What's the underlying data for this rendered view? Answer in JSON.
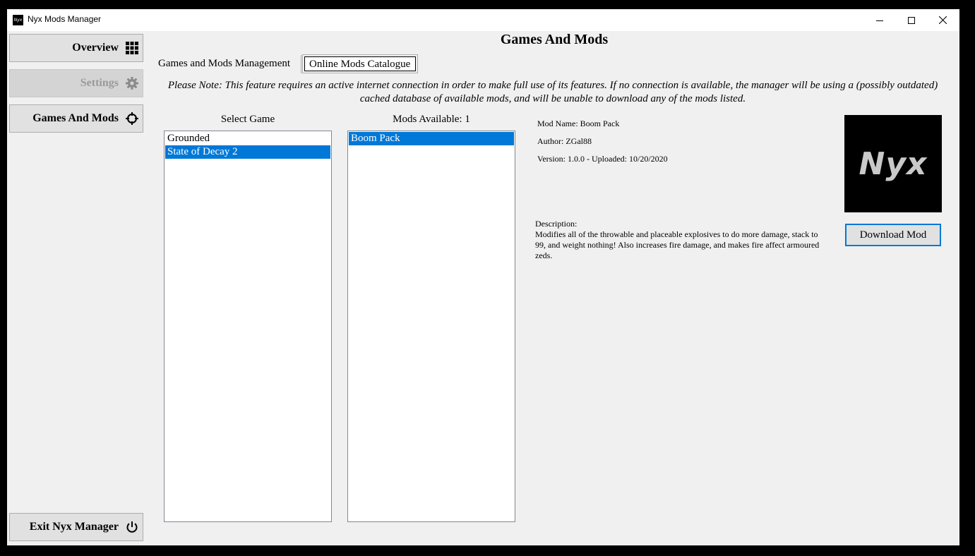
{
  "window": {
    "title": "Nyx Mods Manager",
    "icon_text": "Nyx"
  },
  "sidebar": {
    "items": [
      {
        "label": "Overview",
        "icon": "grid-icon",
        "enabled": true
      },
      {
        "label": "Settings",
        "icon": "gear-icon",
        "enabled": false
      },
      {
        "label": "Games And Mods",
        "icon": "crosshair-icon",
        "enabled": true
      }
    ],
    "exit_label": "Exit Nyx Manager"
  },
  "main": {
    "title": "Games And Mods",
    "tabs": [
      {
        "label": "Games and Mods Management",
        "selected": false
      },
      {
        "label": "Online Mods Catalogue",
        "selected": true
      }
    ],
    "note": "Please Note: This feature requires an active internet connection in order to make full use of its features. If no connection is available, the manager will be using a (possibly outdated) cached database of available mods, and will be unable to download any of the mods listed."
  },
  "games": {
    "label": "Select Game",
    "items": [
      "Grounded",
      "State of Decay 2"
    ],
    "selected": "State of Decay 2"
  },
  "mods": {
    "label": "Mods Available: 1",
    "items": [
      "Boom Pack"
    ],
    "selected": "Boom Pack"
  },
  "details": {
    "name": "Mod Name: Boom Pack",
    "author": "Author: ZGal88",
    "version": "Version: 1.0.0 - Uploaded: 10/20/2020",
    "thumbnail_text": "Nyx",
    "description_label": "Description:",
    "description": "Modifies all of the throwable and placeable explosives to do more damage, stack to 99, and weight nothing! Also increases fire damage, and makes fire affect armoured zeds.",
    "download_label": "Download Mod"
  },
  "colors": {
    "selection": "#0078d7",
    "window_bg": "#f0f0f0",
    "button_bg": "#e1e1e1"
  }
}
